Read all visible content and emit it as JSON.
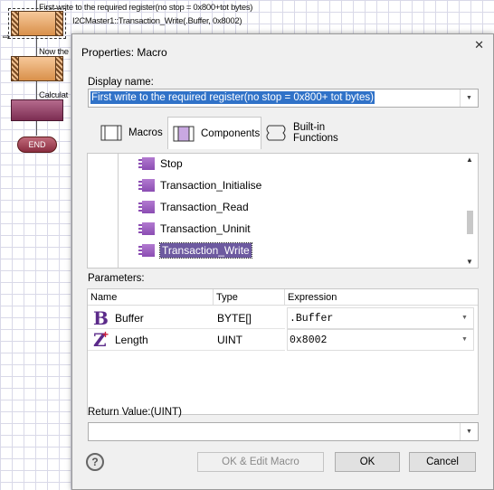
{
  "flowchart": {
    "block1_text": "First write to the required register(no stop = 0x800+tot bytes)",
    "block1_call": "I2CMaster1::Transaction_Write(.Buffer, 0x8002)",
    "block2_text": "Now the",
    "block3_text": "Calculat",
    "end_label": "END"
  },
  "dialog": {
    "title": "Properties: Macro",
    "close_glyph": "✕",
    "display_name_label": "Display name:",
    "display_name_value": "First write to the required register(no stop = 0x800+ tot bytes)",
    "tabs": [
      {
        "label": "Macros"
      },
      {
        "label": "Components"
      },
      {
        "label": "Built-in Functions"
      }
    ],
    "tree_items": [
      "Stop",
      "Transaction_Initialise",
      "Transaction_Read",
      "Transaction_Uninit",
      "Transaction_Write"
    ],
    "selected_item": "Transaction_Write",
    "parameters_label": "Parameters:",
    "columns": [
      "Name",
      "Type",
      "Expression"
    ],
    "params": [
      {
        "icon": "B",
        "name": "Buffer",
        "type": "BYTE[]",
        "expression": ".Buffer"
      },
      {
        "icon": "Z",
        "name": "Length",
        "type": "UINT",
        "expression": "0x8002"
      }
    ],
    "return_label": "Return Value:(UINT)",
    "return_value": "",
    "buttons": {
      "ok_edit": "OK & Edit Macro",
      "ok": "OK",
      "cancel": "Cancel"
    },
    "help_glyph": "?"
  },
  "colors": {
    "selection": "#3072c8",
    "tree_selection": "#6d5aa0",
    "icon_purple": "#8b4db3",
    "param_icon": "#5b2a8a",
    "param_icon_plus": "#d0203a"
  }
}
